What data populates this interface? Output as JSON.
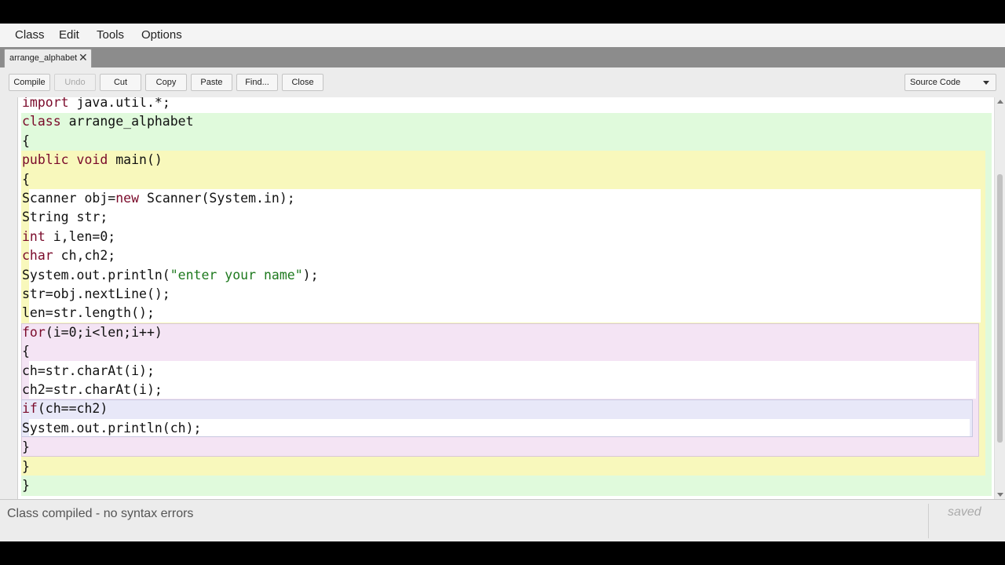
{
  "menu": {
    "items": [
      "Class",
      "Edit",
      "Tools",
      "Options"
    ]
  },
  "tab": {
    "label": "arrange_alphabet",
    "close_icon": "close-icon"
  },
  "toolbar": {
    "buttons": [
      {
        "label": "Compile",
        "enabled": true
      },
      {
        "label": "Undo",
        "enabled": false
      },
      {
        "label": "Cut",
        "enabled": true
      },
      {
        "label": "Copy",
        "enabled": true
      },
      {
        "label": "Paste",
        "enabled": true
      },
      {
        "label": "Find...",
        "enabled": true
      },
      {
        "label": "Close",
        "enabled": true
      }
    ],
    "view_select": {
      "selected": "Source Code"
    }
  },
  "editor": {
    "lines": [
      [
        {
          "t": "import",
          "k": "kw"
        },
        {
          "t": " java.util.*;"
        }
      ],
      [
        {
          "t": "class",
          "k": "kw"
        },
        {
          "t": " arrange_alphabet"
        }
      ],
      [
        {
          "t": "{"
        }
      ],
      [
        {
          "t": "public",
          "k": "kw"
        },
        {
          "t": " "
        },
        {
          "t": "void",
          "k": "kw"
        },
        {
          "t": " main()"
        }
      ],
      [
        {
          "t": "{"
        }
      ],
      [
        {
          "t": "Scanner obj="
        },
        {
          "t": "new",
          "k": "kw"
        },
        {
          "t": " Scanner(System.in);"
        }
      ],
      [
        {
          "t": "String str;"
        }
      ],
      [
        {
          "t": "int",
          "k": "kw"
        },
        {
          "t": " i,len=0;"
        }
      ],
      [
        {
          "t": "char",
          "k": "kw"
        },
        {
          "t": " ch,ch2;"
        }
      ],
      [
        {
          "t": "System.out.println("
        },
        {
          "t": "\"enter your name\"",
          "k": "str"
        },
        {
          "t": ");"
        }
      ],
      [
        {
          "t": "str=obj.nextLine();"
        }
      ],
      [
        {
          "t": "len=str.length();"
        }
      ],
      [
        {
          "t": "for",
          "k": "kw"
        },
        {
          "t": "(i=0;i<len;i++)"
        }
      ],
      [
        {
          "t": "{"
        }
      ],
      [
        {
          "t": "ch=str.charAt(i);"
        }
      ],
      [
        {
          "t": "ch2=str.charAt(i);"
        }
      ],
      [
        {
          "t": "if",
          "k": "kw"
        },
        {
          "t": "(ch==ch2)"
        }
      ],
      [
        {
          "t": "System.out.println(ch);"
        }
      ],
      [
        {
          "t": "}"
        }
      ],
      [
        {
          "t": "}"
        }
      ],
      [
        {
          "t": "}"
        }
      ]
    ],
    "scope_colors": {
      "class": "#e0fadc",
      "method": "#f8f8bc",
      "loop": "#f4e4f4",
      "if": "#e8e8f8",
      "body": "#ffffff"
    }
  },
  "status": {
    "message": "Class compiled - no syntax errors",
    "saved": "saved"
  }
}
